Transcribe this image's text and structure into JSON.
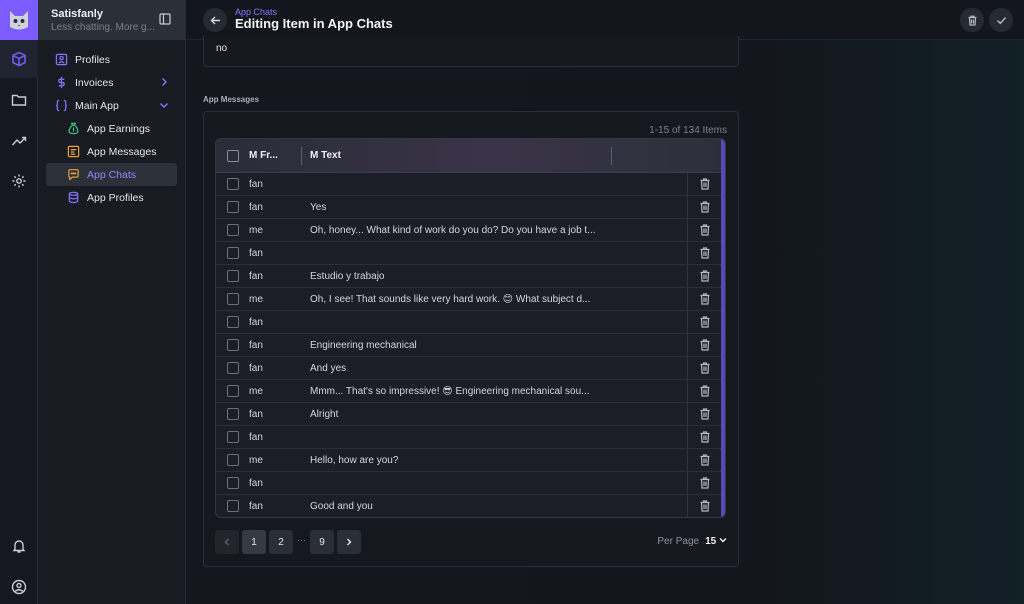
{
  "app": {
    "name": "Satisfanly",
    "tagline": "Less chatting. More g..."
  },
  "header": {
    "breadcrumb": "App Chats",
    "title": "Editing Item in App Chats"
  },
  "sidebar": {
    "items": [
      {
        "label": "Profiles",
        "icon": "profile-icon"
      },
      {
        "label": "Invoices",
        "icon": "dollar-icon"
      },
      {
        "label": "Main App",
        "icon": "braces-icon"
      },
      {
        "label": "App Earnings",
        "icon": "money-bag-icon"
      },
      {
        "label": "App Messages",
        "icon": "messages-icon"
      },
      {
        "label": "App Chats",
        "icon": "chat-icon",
        "active": true
      },
      {
        "label": "App Profiles",
        "icon": "database-icon"
      }
    ]
  },
  "form": {
    "previous_field_value": "no",
    "section_label": "App Messages"
  },
  "table": {
    "count_text": "1-15 of 134 Items",
    "columns": [
      "M Fr...",
      "M Text"
    ],
    "rows": [
      {
        "from": "fan",
        "text": ""
      },
      {
        "from": "fan",
        "text": "Yes"
      },
      {
        "from": "me",
        "text": "Oh, honey... What kind of work do you do? Do you have a job t..."
      },
      {
        "from": "fan",
        "text": ""
      },
      {
        "from": "fan",
        "text": "Estudio y trabajo"
      },
      {
        "from": "me",
        "text": "Oh, I see! That sounds like very hard work. 😊 What subject d..."
      },
      {
        "from": "fan",
        "text": ""
      },
      {
        "from": "fan",
        "text": "Engineering mechanical"
      },
      {
        "from": "fan",
        "text": "And yes"
      },
      {
        "from": "me",
        "text": "Mmm... That's so impressive! 😎 Engineering mechanical sou..."
      },
      {
        "from": "fan",
        "text": "Alright"
      },
      {
        "from": "fan",
        "text": ""
      },
      {
        "from": "me",
        "text": "Hello, how are you?"
      },
      {
        "from": "fan",
        "text": ""
      },
      {
        "from": "fan",
        "text": "Good and you"
      }
    ]
  },
  "pagination": {
    "pages": [
      "1",
      "2",
      "9"
    ],
    "dots": "···",
    "current": "1",
    "per_page_label": "Per Page",
    "per_page_value": "15"
  },
  "colors": {
    "accent": "#7c5cff",
    "background": "#0f1117"
  }
}
